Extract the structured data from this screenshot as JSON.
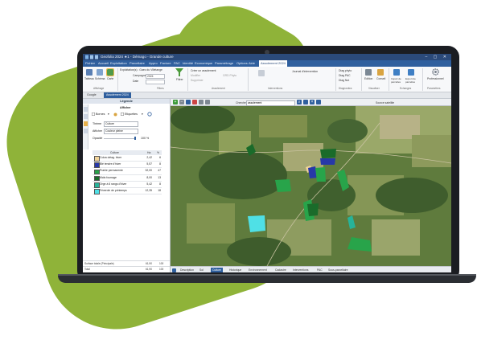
{
  "window": {
    "title": "Geofolia 2024 ★1 - Démago - Grande culture"
  },
  "menu": {
    "items": [
      "Fichier",
      "Accueil",
      "Exploitation",
      "Parcellaire",
      "Appro",
      "Facture",
      "PAC",
      "Identité",
      "Economique",
      "Paramétrage",
      "Options",
      "Aide"
    ],
    "active_tab": "Assolement 2024"
  },
  "ribbon": {
    "view_buttons": [
      "Tableau",
      "Schéma",
      "Carte"
    ],
    "group_affichage": "Affichage",
    "exploitation_label": "Exploitation(s) : Gaec du Villetange",
    "campaign_label": "Campagne",
    "campaign_value": "2024",
    "date_label": "Date",
    "filter_label": "Filtrer",
    "group_filtres": "Filtres",
    "actions": [
      "Créer un assolement",
      "Modifier",
      "Supprimer",
      "GRD Phyto"
    ],
    "group_assolement": "Assolement",
    "group_intervention": "Interventions",
    "journal_label": "Journal d'intervention",
    "diag_buttons": [
      "Diag phyto",
      "Diag PAC",
      "Diag Nut"
    ],
    "group_diagnostics": "Diagnostics",
    "edition": "Edition",
    "conseil": "Conseil",
    "group_visualiser": "Visualiser",
    "import_parcelles": "Import de parcelles",
    "export_parcelles": "Export de parcelles",
    "group_echanges": "Echanges",
    "professionnel": "Professionnel",
    "group_parametres": "Paramètres"
  },
  "doc_tabs": [
    "Google",
    "Assolement 2024"
  ],
  "legend_panel": {
    "title": "Légende",
    "afficher_title": "Afficher",
    "bornes_label": "Bornes",
    "etiquettes_label": "Etiquettes",
    "theme_label": "Thème",
    "theme_value": "Culture",
    "afficher_label": "Afficher",
    "afficher_value": "Couleur pleine",
    "opacite_label": "Opacité",
    "opacite_value": "100 %",
    "opacite_level": 1.0,
    "table_headers": {
      "culture": "Culture",
      "ha": "Ha",
      "pct": "%"
    },
    "rows": [
      {
        "name": "Colza oléag. hiver",
        "ha": "2,42",
        "pct": "6",
        "color": "#f0d39a"
      },
      {
        "name": "Blé tendre d'hiver",
        "ha": "5,57",
        "pct": "8",
        "color": "#2738a8"
      },
      {
        "name": "Prairie permanente",
        "ha": "32,00",
        "pct": "47",
        "color": "#28a44a"
      },
      {
        "name": "Maïs fourrage",
        "ha": "8,00",
        "pct": "13",
        "color": "#1a6b2a"
      },
      {
        "name": "Orge à 6 rangs d'hiver",
        "ha": "5,42",
        "pct": "8",
        "color": "#27b39a"
      },
      {
        "name": "Féverole de printemps",
        "ha": "12,35",
        "pct": "18",
        "color": "#4fe0e6"
      }
    ],
    "footer": [
      {
        "label": "Surface totale (Principale)",
        "ha": "61,90",
        "pct": "100"
      },
      {
        "label": "Total",
        "ha": "61,90",
        "pct": "100"
      }
    ]
  },
  "map": {
    "search_label": "Cherche :",
    "search_value": "assolement",
    "source_label": "Source satellite",
    "parcels": [
      {
        "crop": "Maïs fourrage",
        "color": "#1a6b2a"
      },
      {
        "crop": "Blé tendre d'hiver",
        "color": "#2738a8"
      },
      {
        "crop": "Prairie permanente",
        "color": "#28a44a"
      },
      {
        "crop": "Colza oléag. hiver",
        "color": "#f0d39a"
      },
      {
        "crop": "Féverole de printemps",
        "color": "#4fe0e6"
      },
      {
        "crop": "Orge à 6 rangs d'hiver",
        "color": "#27b39a"
      }
    ]
  },
  "bottom_tabs": [
    "Description",
    "Sol",
    "Culture",
    "Historique",
    "Environnement",
    "Cadastre",
    "Interventions",
    "PAC",
    "Sous-parcellaire"
  ],
  "bottom_active": "Culture",
  "colors": {
    "brand_green": "#8fb339",
    "ribbon_blue": "#2f5f9e",
    "title_blue": "#2b4a7a"
  }
}
